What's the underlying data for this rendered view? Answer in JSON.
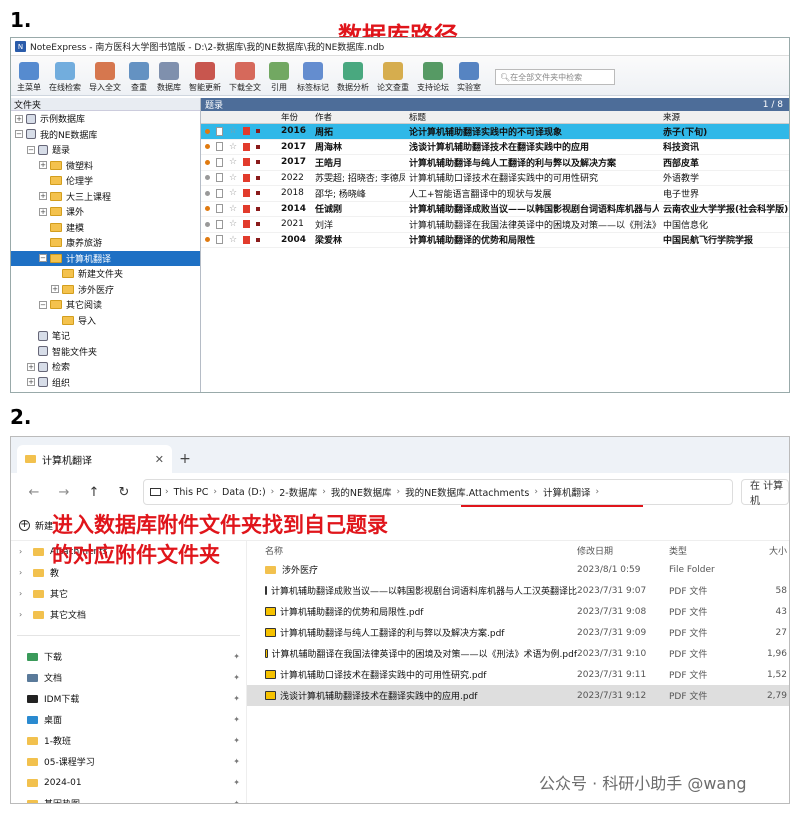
{
  "labels": {
    "step1": "1.",
    "step2": "2.",
    "annot1": "数据库路径",
    "annot2_line1": "进入数据库附件文件夹找到自己题录",
    "annot2_line2": "的对应附件文件夹"
  },
  "panel1": {
    "window_title": "NoteExpress - 南方医科大学图书馆版 - D:\\2-数据库\\我的NE数据库\\我的NE数据库.ndb",
    "toolbar": [
      "主菜单",
      "在线检索",
      "导入全文",
      "查重",
      "数据库",
      "智能更新",
      "下载全文",
      "引用",
      "标签标记",
      "数据分析",
      "论文查重",
      "支持论坛",
      "实验室"
    ],
    "search_placeholder": "在全部文件夹中检索",
    "tree_header": "文件夹",
    "tree": [
      {
        "label": "示例数据库",
        "indent": 0,
        "exp": "+",
        "icon": "db"
      },
      {
        "label": "我的NE数据库",
        "indent": 0,
        "exp": "−",
        "icon": "db"
      },
      {
        "label": "题录",
        "indent": 1,
        "exp": "−",
        "icon": "list"
      },
      {
        "label": "微塑料",
        "indent": 2,
        "exp": "+",
        "icon": "folder"
      },
      {
        "label": "伦理学",
        "indent": 2,
        "exp": "",
        "icon": "folder"
      },
      {
        "label": "大三上课程",
        "indent": 2,
        "exp": "+",
        "icon": "folder"
      },
      {
        "label": "课外",
        "indent": 2,
        "exp": "+",
        "icon": "folder"
      },
      {
        "label": "建模",
        "indent": 2,
        "exp": "",
        "icon": "folder"
      },
      {
        "label": "康养旅游",
        "indent": 2,
        "exp": "",
        "icon": "folder"
      },
      {
        "label": "计算机翻译",
        "indent": 2,
        "exp": "−",
        "icon": "folder",
        "selected": true
      },
      {
        "label": "新建文件夹",
        "indent": 3,
        "exp": "",
        "icon": "folder"
      },
      {
        "label": "涉外医疗",
        "indent": 3,
        "exp": "+",
        "icon": "folder"
      },
      {
        "label": "其它阅读",
        "indent": 2,
        "exp": "−",
        "icon": "folder"
      },
      {
        "label": "导入",
        "indent": 3,
        "exp": "",
        "icon": "folder"
      },
      {
        "label": "笔记",
        "indent": 1,
        "exp": "",
        "icon": "note"
      },
      {
        "label": "智能文件夹",
        "indent": 1,
        "exp": "",
        "icon": "smart"
      },
      {
        "label": "检索",
        "indent": 1,
        "exp": "+",
        "icon": "search"
      },
      {
        "label": "组织",
        "indent": 1,
        "exp": "+",
        "icon": "org"
      }
    ],
    "grid_title": "题录",
    "page_count": "1 / 8",
    "columns": [
      "年份",
      "作者",
      "标题",
      "来源"
    ],
    "rows": [
      {
        "year": "2016",
        "author": "周拓",
        "title": "论计算机辅助翻译实践中的不可译现象",
        "source": "赤子(下旬)",
        "bold": true,
        "highlight": true,
        "dot": "#e07a10"
      },
      {
        "year": "2017",
        "author": "周海林",
        "title": "浅谈计算机辅助翻译技术在翻译实践中的应用",
        "source": "科技资讯",
        "bold": true,
        "dot": "#e07a10"
      },
      {
        "year": "2017",
        "author": "王皓月",
        "title": "计算机辅助翻译与纯人工翻译的利与弊以及解决方案",
        "source": "西部皮革",
        "bold": true,
        "dot": "#e07a10"
      },
      {
        "year": "2022",
        "author": "苏雯超; 招晓杏; 李德凤",
        "title": "计算机辅助口译技术在翻译实践中的可用性研究",
        "source": "外语教学",
        "bold": false,
        "dot": "#999"
      },
      {
        "year": "2018",
        "author": "邵华; 杨晓峰",
        "title": "人工+智能语言翻译中的现状与发展",
        "source": "电子世界",
        "bold": false,
        "dot": "#999"
      },
      {
        "year": "2014",
        "author": "任诚刚",
        "title": "计算机辅助翻译成败当议——以韩国影视剧台词语料库机器与人…",
        "source": "云南农业大学学报(社会科学版)",
        "bold": true,
        "dot": "#e07a10"
      },
      {
        "year": "2021",
        "author": "刘洋",
        "title": "计算机辅助翻译在我国法律英译中的困境及对策——以《刑法》…",
        "source": "中国信息化",
        "bold": false,
        "dot": "#999"
      },
      {
        "year": "2004",
        "author": "梁爱林",
        "title": "计算机辅助翻译的优势和局限性",
        "source": "中国民航飞行学院学报",
        "bold": true,
        "dot": "#e07a10"
      }
    ]
  },
  "panel2": {
    "tab_title": "计算机翻译",
    "breadcrumbs": [
      "This PC",
      "Data (D:)",
      "2-数据库",
      "我的NE数据库",
      "我的NE数据库.Attachments",
      "计算机翻译"
    ],
    "search_text": "在 计算机",
    "new_label": "新建",
    "nav_top": [
      {
        "label": "Attachments"
      },
      {
        "label": "教"
      },
      {
        "label": "其它"
      },
      {
        "label": "其它文档"
      }
    ],
    "nav_quick": [
      {
        "label": "下载",
        "icon": "download"
      },
      {
        "label": "文档",
        "icon": "doc"
      },
      {
        "label": "IDM下载",
        "icon": "idm"
      },
      {
        "label": "桌面",
        "icon": "desktop"
      },
      {
        "label": "1-教班",
        "icon": "folder"
      },
      {
        "label": "05-课程学习",
        "icon": "folder"
      },
      {
        "label": "2024-01",
        "icon": "folder"
      },
      {
        "label": "基因热图",
        "icon": "folder"
      }
    ],
    "file_columns": [
      "名称",
      "修改日期",
      "类型",
      "大小"
    ],
    "files": [
      {
        "name": "涉外医疗",
        "date": "2023/8/1 0:59",
        "type": "File Folder",
        "size": "",
        "folder": true
      },
      {
        "name": "计算机辅助翻译成败当议——以韩国影视剧台词语料库机器与人工汉英翻译比较为例.pdf",
        "date": "2023/7/31 9:07",
        "type": "PDF 文件",
        "size": "58"
      },
      {
        "name": "计算机辅助翻译的优势和局限性.pdf",
        "date": "2023/7/31 9:08",
        "type": "PDF 文件",
        "size": "43"
      },
      {
        "name": "计算机辅助翻译与纯人工翻译的利与弊以及解决方案.pdf",
        "date": "2023/7/31 9:09",
        "type": "PDF 文件",
        "size": "27"
      },
      {
        "name": "计算机辅助翻译在我国法律英译中的困境及对策——以《刑法》术语为例.pdf",
        "date": "2023/7/31 9:10",
        "type": "PDF 文件",
        "size": "1,96"
      },
      {
        "name": "计算机辅助口译技术在翻译实践中的可用性研究.pdf",
        "date": "2023/7/31 9:11",
        "type": "PDF 文件",
        "size": "1,52"
      },
      {
        "name": "浅谈计算机辅助翻译技术在翻译实践中的应用.pdf",
        "date": "2023/7/31 9:12",
        "type": "PDF 文件",
        "size": "2,79",
        "selected": true
      }
    ],
    "watermark": "公众号 · 科研小助手 @wang"
  },
  "colors": {
    "accent_red": "#e0151b",
    "selected_blue": "#1e70c4",
    "highlight_cyan": "#30b8e8"
  }
}
